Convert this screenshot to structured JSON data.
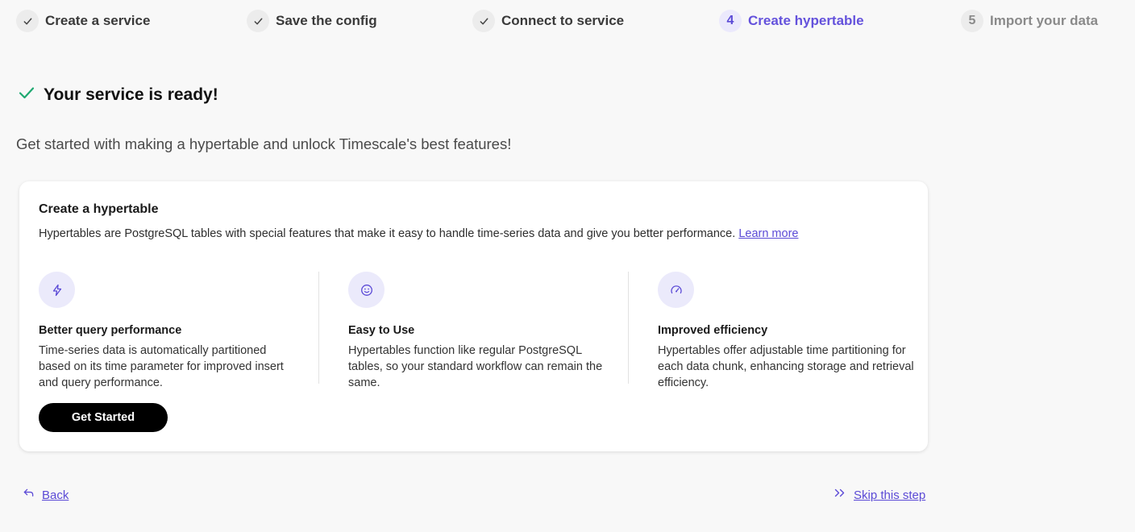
{
  "stepper": {
    "steps": [
      {
        "label": "Create a service",
        "status": "done"
      },
      {
        "label": "Save the config",
        "status": "done"
      },
      {
        "label": "Connect to service",
        "status": "done"
      },
      {
        "number": "4",
        "label": "Create hypertable",
        "status": "active"
      },
      {
        "number": "5",
        "label": "Import your data",
        "status": "todo"
      }
    ]
  },
  "ready": {
    "title": "Your service is ready!"
  },
  "subtitle": "Get started with making a hypertable and unlock Timescale's best features!",
  "card": {
    "title": "Create a hypertable",
    "description": "Hypertables are PostgreSQL tables with special features that make it easy to handle time-series data and give you better performance.",
    "learn_more": "Learn more",
    "features": [
      {
        "icon": "lightning-icon",
        "title": "Better query performance",
        "description": "Time-series data is automatically partitioned based on its time parameter for improved insert and query performance."
      },
      {
        "icon": "smiley-icon",
        "title": "Easy to Use",
        "description": "Hypertables function like regular PostgreSQL tables, so your standard workflow can remain the same."
      },
      {
        "icon": "gauge-icon",
        "title": "Improved efficiency",
        "description": "Hypertables offer adjustable time partitioning for each data chunk, enhancing storage and retrieval efficiency."
      }
    ],
    "button_label": "Get Started"
  },
  "nav": {
    "back": "Back",
    "skip": "Skip this step"
  },
  "colors": {
    "accent": "#5b4ad6",
    "success": "#1fa971",
    "background": "#f8f8f8"
  }
}
